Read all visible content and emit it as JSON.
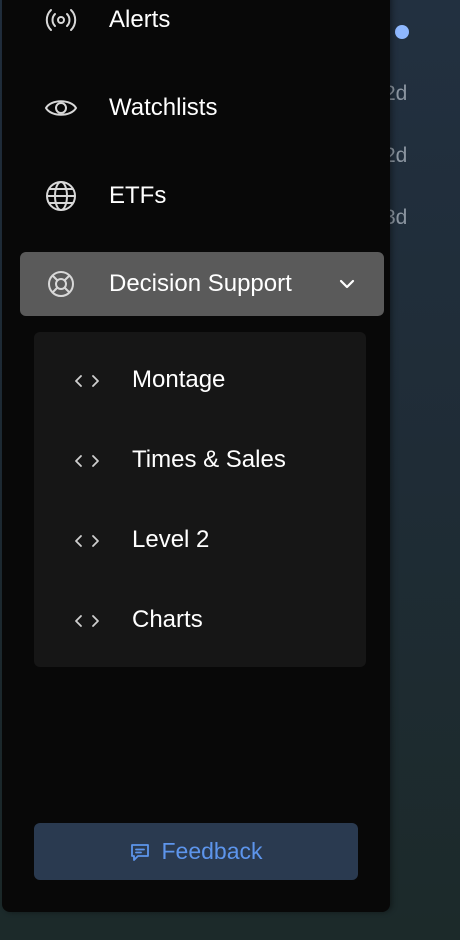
{
  "background": {
    "labels": [
      "2d",
      "2d",
      "3d"
    ]
  },
  "nav": {
    "items": [
      {
        "label": "Alerts",
        "icon": "broadcast-icon"
      },
      {
        "label": "Watchlists",
        "icon": "eye-icon"
      },
      {
        "label": "ETFs",
        "icon": "globe-icon"
      },
      {
        "label": "Decision Support",
        "icon": "lifebuoy-icon",
        "active": true,
        "expanded": true
      }
    ]
  },
  "submenu": {
    "items": [
      {
        "label": "Montage",
        "icon": "code-icon"
      },
      {
        "label": "Times & Sales",
        "icon": "code-icon"
      },
      {
        "label": "Level 2",
        "icon": "code-icon"
      },
      {
        "label": "Charts",
        "icon": "code-icon"
      }
    ]
  },
  "feedback": {
    "label": "Feedback",
    "icon": "message-icon"
  },
  "colors": {
    "accent": "#5d95ec",
    "active_bg": "#5a5a5a",
    "panel_bg": "#080808",
    "submenu_bg": "#161616",
    "feedback_bg": "#2a3a50"
  }
}
